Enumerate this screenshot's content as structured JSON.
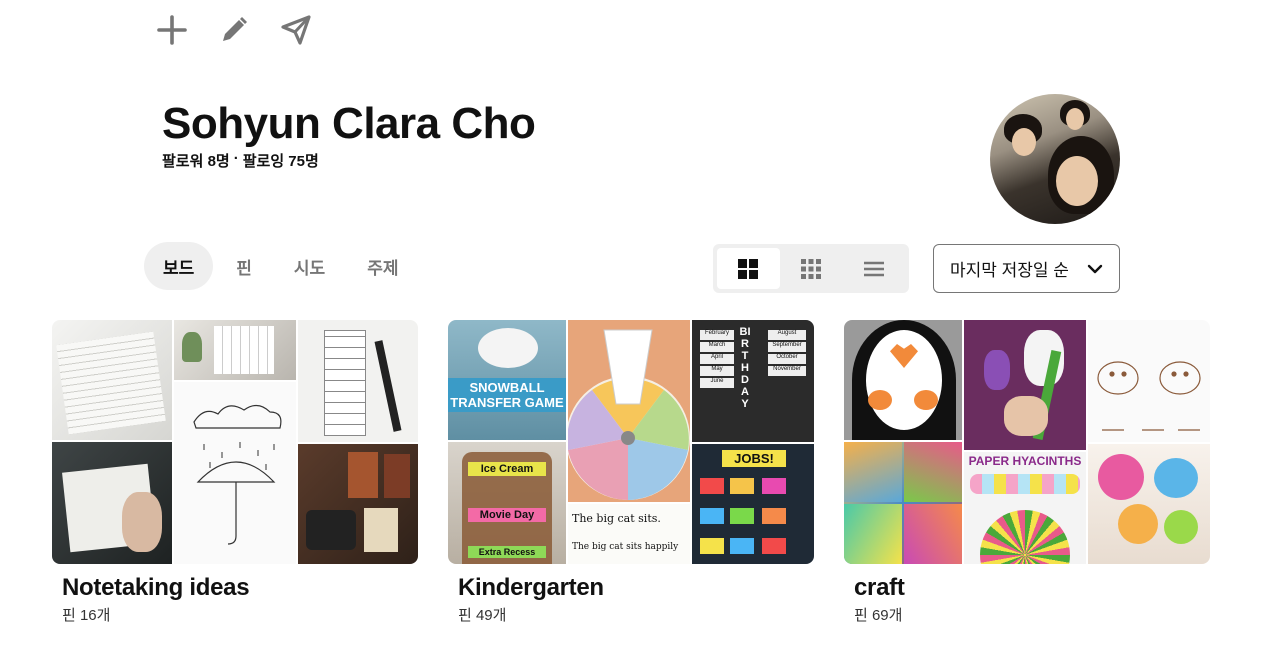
{
  "toolbar": {
    "items": [
      "add-icon",
      "edit-icon",
      "share-icon"
    ]
  },
  "profile": {
    "name": "Sohyun Clara Cho",
    "followers": "팔로워 8명",
    "separator": "·",
    "following": "팔로잉 75명"
  },
  "tabs": [
    {
      "label": "보드",
      "active": true
    },
    {
      "label": "핀",
      "active": false
    },
    {
      "label": "시도",
      "active": false
    },
    {
      "label": "주제",
      "active": false
    }
  ],
  "view_toggle": {
    "options": [
      "large-grid-icon",
      "small-grid-icon",
      "list-icon"
    ],
    "selected": "large-grid-icon"
  },
  "sort": {
    "label": "마지막 저장일 순"
  },
  "boards": [
    {
      "title": "Notetaking ideas",
      "count": "핀 16개"
    },
    {
      "title": "Kindergarten",
      "count": "핀 49개",
      "image_text": {
        "snowball": "SNOWBALL TRANSFER GAME",
        "ice_cream": "Ice Cream",
        "movie_day": "Movie Day",
        "extra_recess": "Extra Recess",
        "big_cat": "The big cat sits.",
        "big_cat_2": "The big cat sits happily",
        "jobs": "JOBS!",
        "birthday": "BIRTHDAY",
        "months": [
          "February",
          "March",
          "April",
          "May",
          "June",
          "August",
          "September",
          "October",
          "November"
        ]
      }
    },
    {
      "title": "craft",
      "count": "핀 69개",
      "image_text": {
        "paper_hyacinths": "PAPER HYACINTHS"
      }
    }
  ],
  "colors": {
    "accent": "#111111",
    "muted": "#767676",
    "pill_bg": "#efefef"
  }
}
